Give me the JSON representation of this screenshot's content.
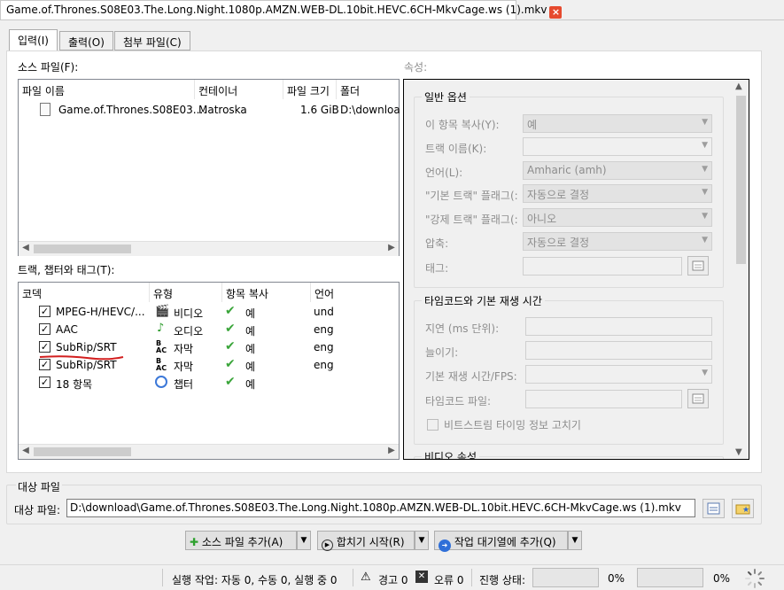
{
  "document_tab": {
    "title": "Game.of.Thrones.S08E03.The.Long.Night.1080p.AMZN.WEB-DL.10bit.HEVC.6CH-MkvCage.ws (1).mkv",
    "close": "×"
  },
  "tabs": [
    "입력(I)",
    "출력(O)",
    "첨부 파일(C)"
  ],
  "source_files": {
    "label": "소스 파일(F):",
    "columns": [
      "파일 이름",
      "컨테이너",
      "파일 크기",
      "폴더"
    ],
    "rows": [
      {
        "name": "Game.of.Thrones.S08E03....",
        "container": "Matroska",
        "size": "1.6 GiB",
        "folder": "D:\\downloa"
      }
    ]
  },
  "tracks": {
    "label": "트랙, 챕터와 태그(T):",
    "columns": [
      "코덱",
      "유형",
      "항목 복사",
      "언어"
    ],
    "rows": [
      {
        "codec": "MPEG-H/HEVC/...",
        "type": "비디오",
        "copy": "예",
        "lang": "und",
        "icon": "video-icon"
      },
      {
        "codec": "AAC",
        "type": "오디오",
        "copy": "예",
        "lang": "eng",
        "icon": "audio-icon"
      },
      {
        "codec": "SubRip/SRT",
        "type": "자막",
        "copy": "예",
        "lang": "eng",
        "icon": "subtitle-icon"
      },
      {
        "codec": "SubRip/SRT",
        "type": "자막",
        "copy": "예",
        "lang": "eng",
        "icon": "subtitle-icon"
      },
      {
        "codec": "18 항목",
        "type": "챕터",
        "copy": "예",
        "lang": "",
        "icon": "chapter-icon"
      }
    ],
    "underline_color": "#d21f1f"
  },
  "properties": {
    "label": "속성:",
    "general": {
      "title": "일반 옵션",
      "copy_label": "이 항목 복사(Y):",
      "copy_value": "예",
      "name_label": "트랙 이름(K):",
      "name_value": "",
      "lang_label": "언어(L):",
      "lang_value": "Amharic (amh)",
      "default_label": "\"기본 트랙\" 플래그(:",
      "default_value": "자동으로 결정",
      "forced_label": "\"강제 트랙\" 플래그(:",
      "forced_value": "아니오",
      "compress_label": "압축:",
      "compress_value": "자동으로 결정",
      "tags_label": "태그:"
    },
    "timecode": {
      "title": "타임코드와 기본 재생 시간",
      "delay_label": "지연 (ms 단위):",
      "stretch_label": "늘이기:",
      "fps_label": "기본 재생 시간/FPS:",
      "tc_file_label": "타임코드 파일:",
      "fix_bitstream_label": "비트스트림 타이밍 정보 고치기"
    },
    "video_title": "비디오 속성"
  },
  "output": {
    "group_label": "대상 파일",
    "field_label": "대상 파일:",
    "path": "D:\\download\\Game.of.Thrones.S08E03.The.Long.Night.1080p.AMZN.WEB-DL.10bit.HEVC.6CH-MkvCage.ws (1).mkv"
  },
  "actions": {
    "add_source": "소스 파일 추가(A)",
    "start_mux": "합치기 시작(R)",
    "add_queue": "작업 대기열에 추가(Q)"
  },
  "status": {
    "jobs": "실행 작업:  자동 0, 수동 0, 실행 중 0",
    "warnings": "경고 0",
    "errors": "오류 0",
    "progress_label": "진행 상태:",
    "progress_pct": "0%",
    "total_pct": "0%",
    "progress_value": 0,
    "total_value": 0
  }
}
